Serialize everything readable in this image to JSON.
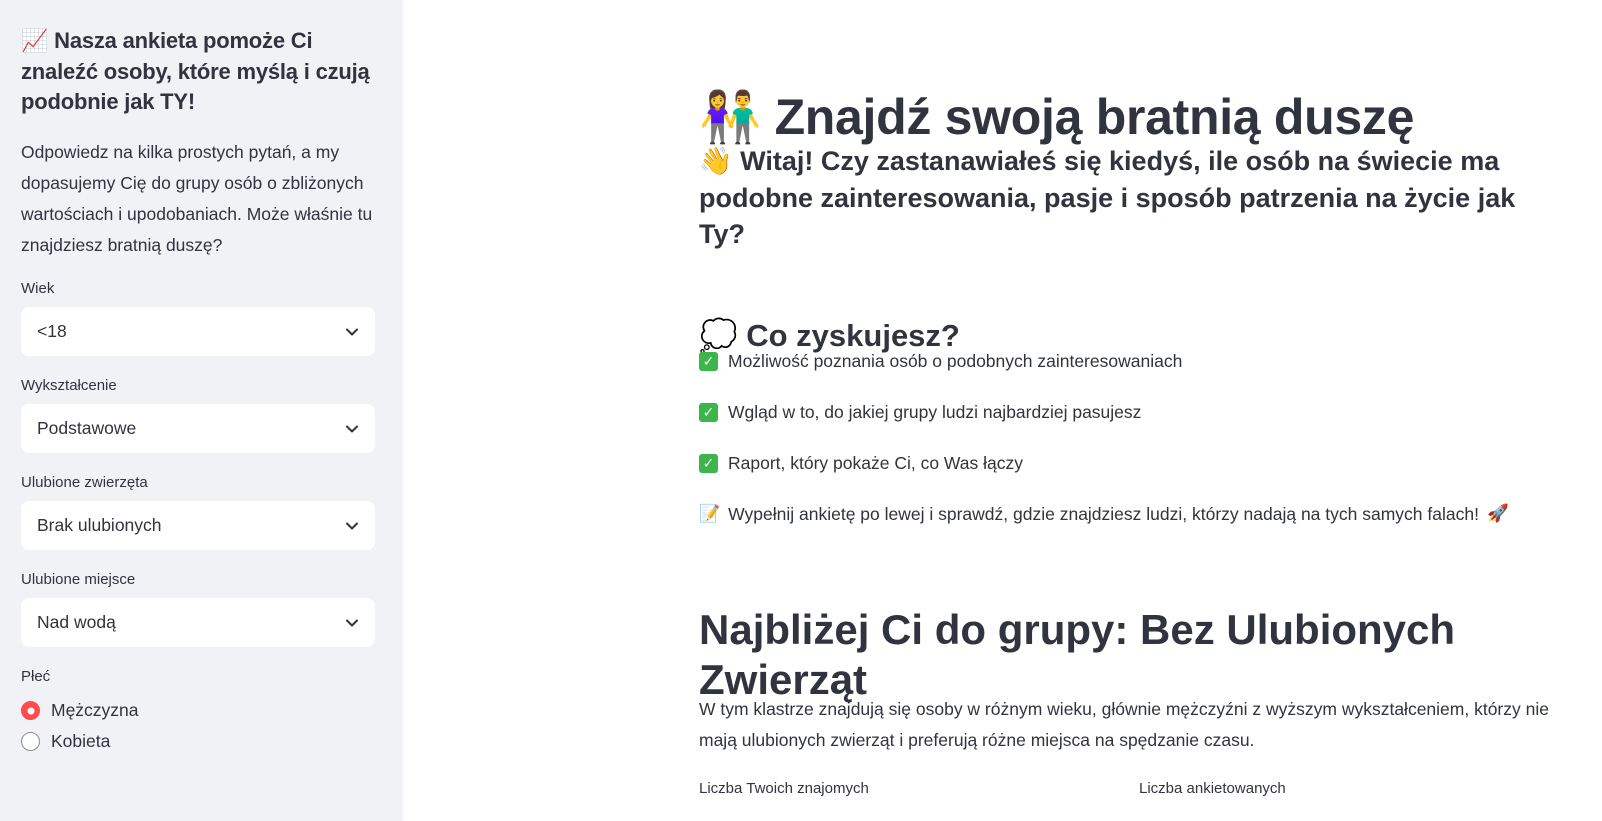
{
  "sidebar": {
    "title_icon": "📈",
    "title": "Nasza ankieta pomoże Ci znaleźć osoby, które myślą i czują podobnie jak TY!",
    "intro": "Odpowiedz na kilka prostych pytań, a my dopasujemy Cię do grupy osób o zbliżonych wartościach i upodobaniach. Może właśnie tu znajdziesz bratnią duszę?",
    "fields": [
      {
        "label": "Wiek",
        "value": "<18"
      },
      {
        "label": "Wykształcenie",
        "value": "Podstawowe"
      },
      {
        "label": "Ulubione zwierzęta",
        "value": "Brak ulubionych"
      },
      {
        "label": "Ulubione miejsce",
        "value": "Nad wodą"
      }
    ],
    "gender": {
      "label": "Płeć",
      "options": [
        "Mężczyzna",
        "Kobieta"
      ],
      "selected": "Mężczyzna"
    }
  },
  "main": {
    "title_icon": "👫",
    "title": "Znajdź swoją bratnią duszę",
    "intro_icon": "👋",
    "intro": "Witaj! Czy zastanawiałeś się kiedyś, ile osób na świecie ma podobne zainteresowania, pasje i sposób patrzenia na życie jak Ty?",
    "benefits_icon": "💭",
    "benefits_title": "Co zyskujesz?",
    "benefits": [
      "Możliwość poznania osób o podobnych zainteresowaniach",
      "Wgląd w to, do jakiej grupy ludzi najbardziej pasujesz",
      "Raport, który pokaże Ci, co Was łączy"
    ],
    "cta_icon": "📝",
    "cta": "Wypełnij ankietę po lewej i sprawdź, gdzie znajdziesz ludzi, którzy nadają na tych samych falach!",
    "cta_end_icon": "🚀",
    "cluster_title": "Najbliżej Ci do grupy: Bez Ulubionych Zwierząt",
    "cluster_desc": "W tym klastrze znajdują się osoby w różnym wieku, głównie mężczyźni z wyższym wykształceniem, którzy nie mają ulubionych zwierząt i preferują różne miejsca na spędzanie czasu.",
    "metrics": [
      "Liczba Twoich znajomych",
      "Liczba ankietowanych"
    ]
  },
  "colors": {
    "accent": "#ff4b4b",
    "sidebar_bg": "#f0f2f6",
    "text": "#31333f",
    "check_green": "#3cb54a"
  }
}
